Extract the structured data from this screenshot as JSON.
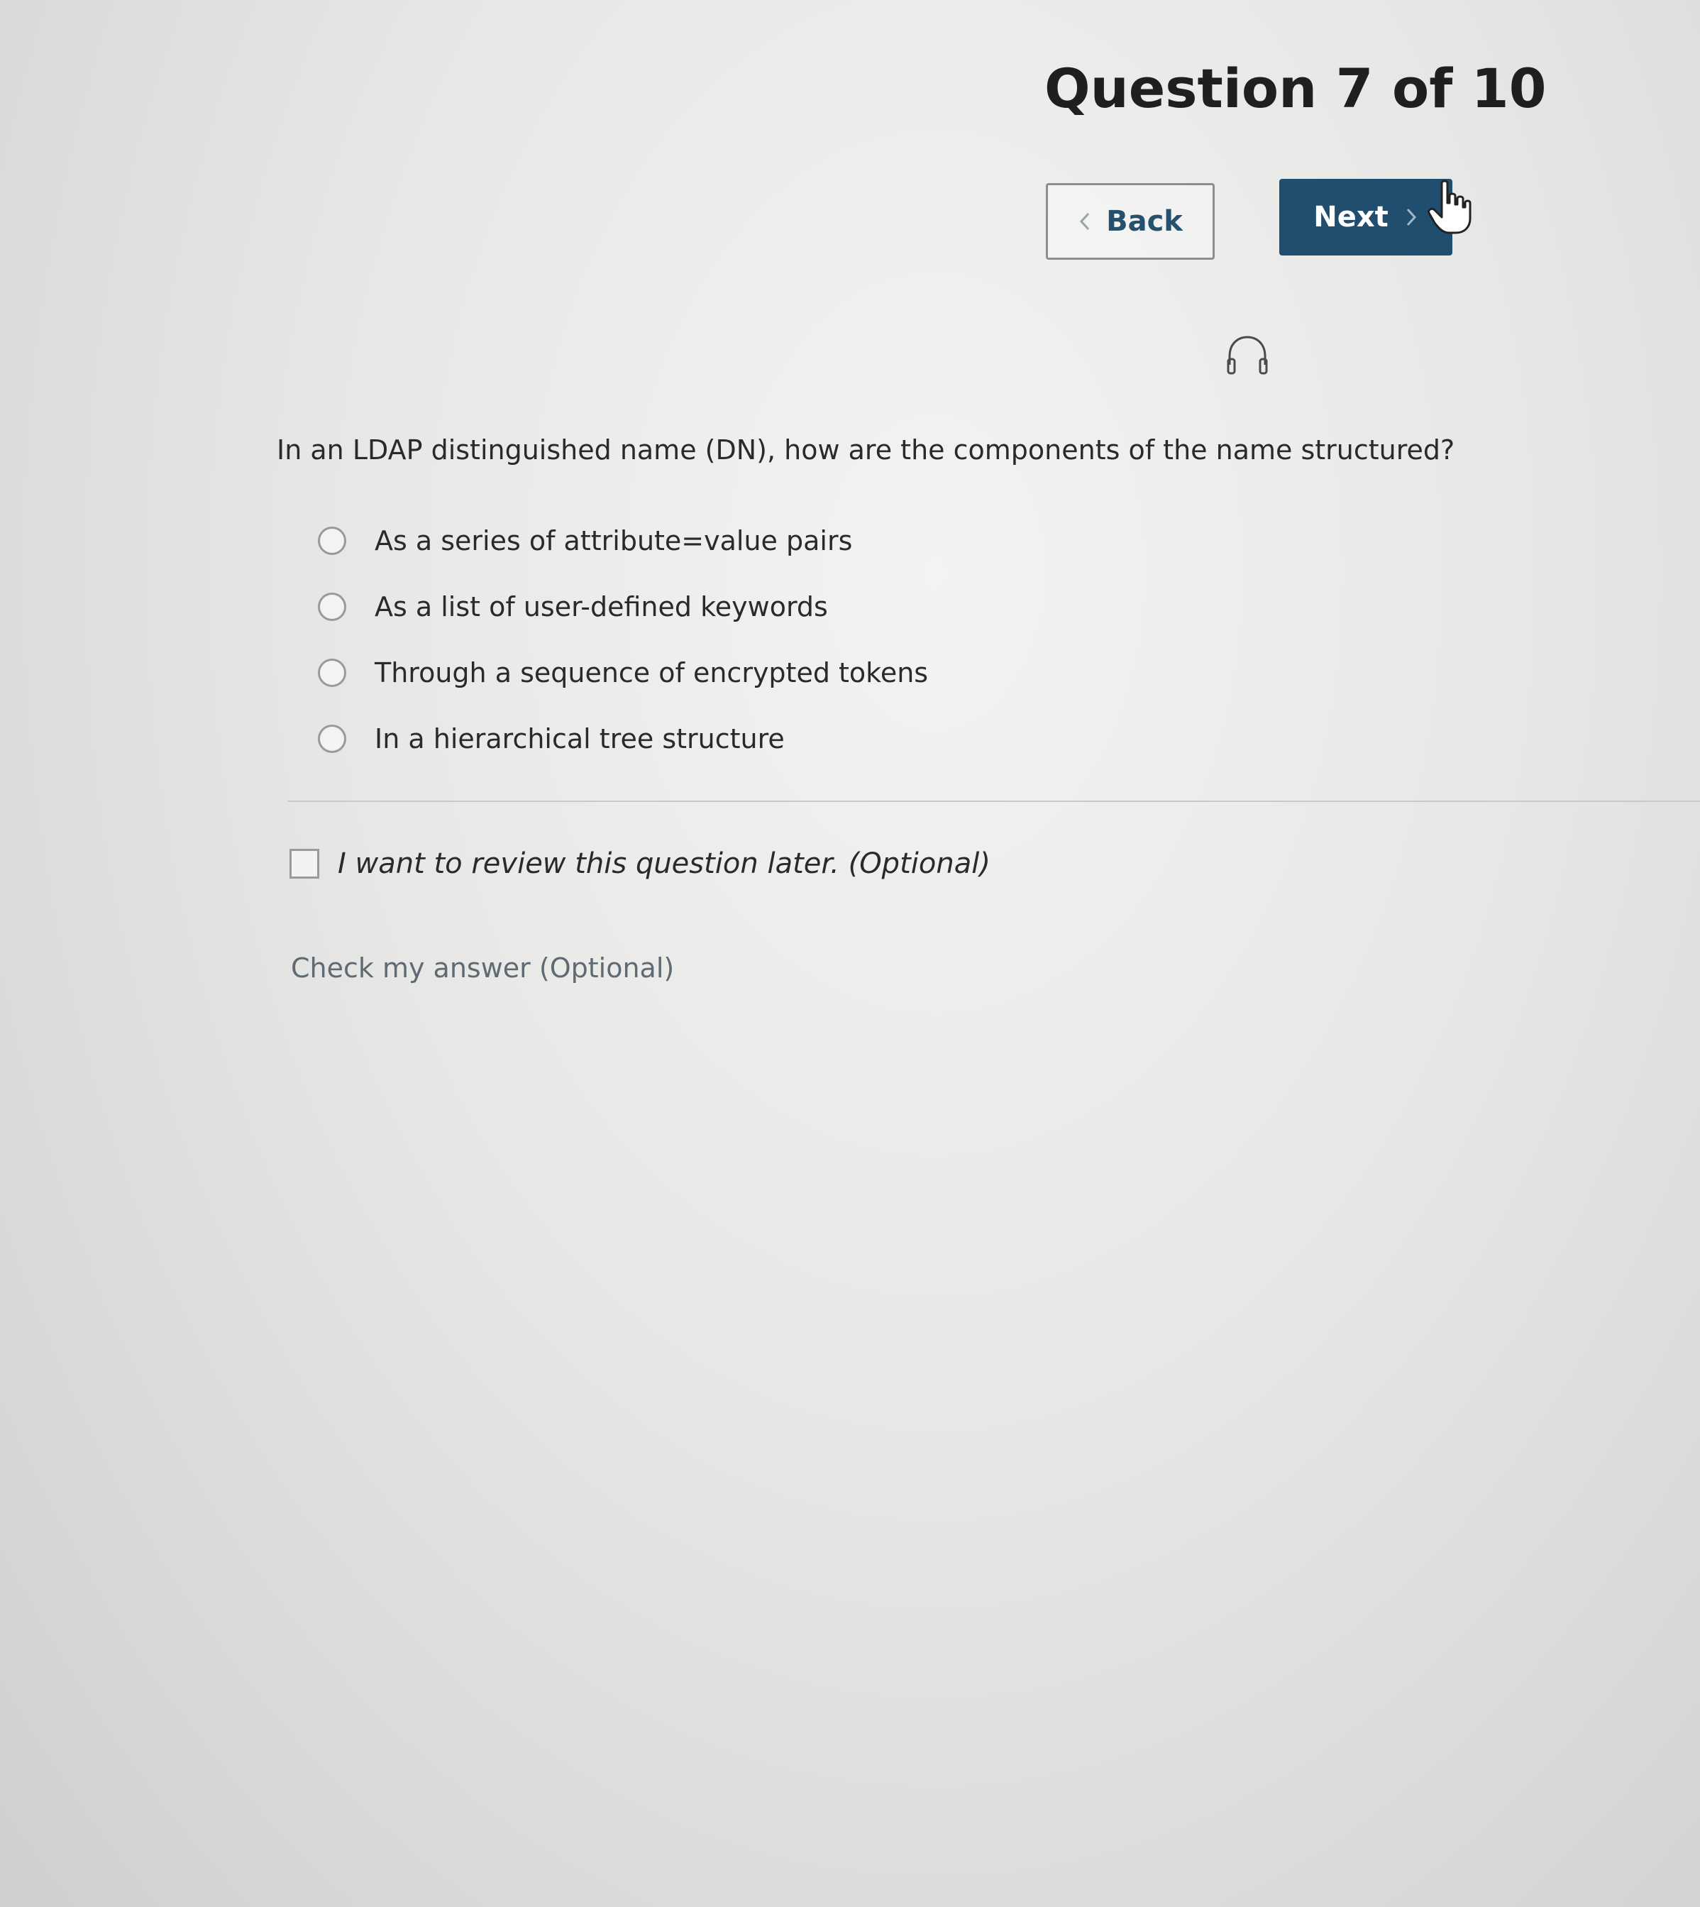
{
  "header": {
    "title": "Question 7 of 10"
  },
  "nav": {
    "back_label": "Back",
    "next_label": "Next"
  },
  "icons": {
    "back": "chevron-left-icon",
    "next": "chevron-right-icon",
    "audio": "headphones-icon",
    "cursor": "hand-pointer-icon"
  },
  "question": {
    "text": "In an LDAP distinguished name (DN), how are the components of the name structured?",
    "options": [
      {
        "label": "As a series of attribute=value pairs"
      },
      {
        "label": "As a list of user-defined keywords"
      },
      {
        "label": "Through a sequence of encrypted tokens"
      },
      {
        "label": "In a hierarchical tree structure"
      }
    ]
  },
  "review": {
    "label": "I want to review this question later. (Optional)"
  },
  "check_answer": {
    "label": "Check my answer (Optional)"
  },
  "colors": {
    "primary": "#214e6f",
    "back_text": "#25506e",
    "link_text": "#5f6a72"
  }
}
